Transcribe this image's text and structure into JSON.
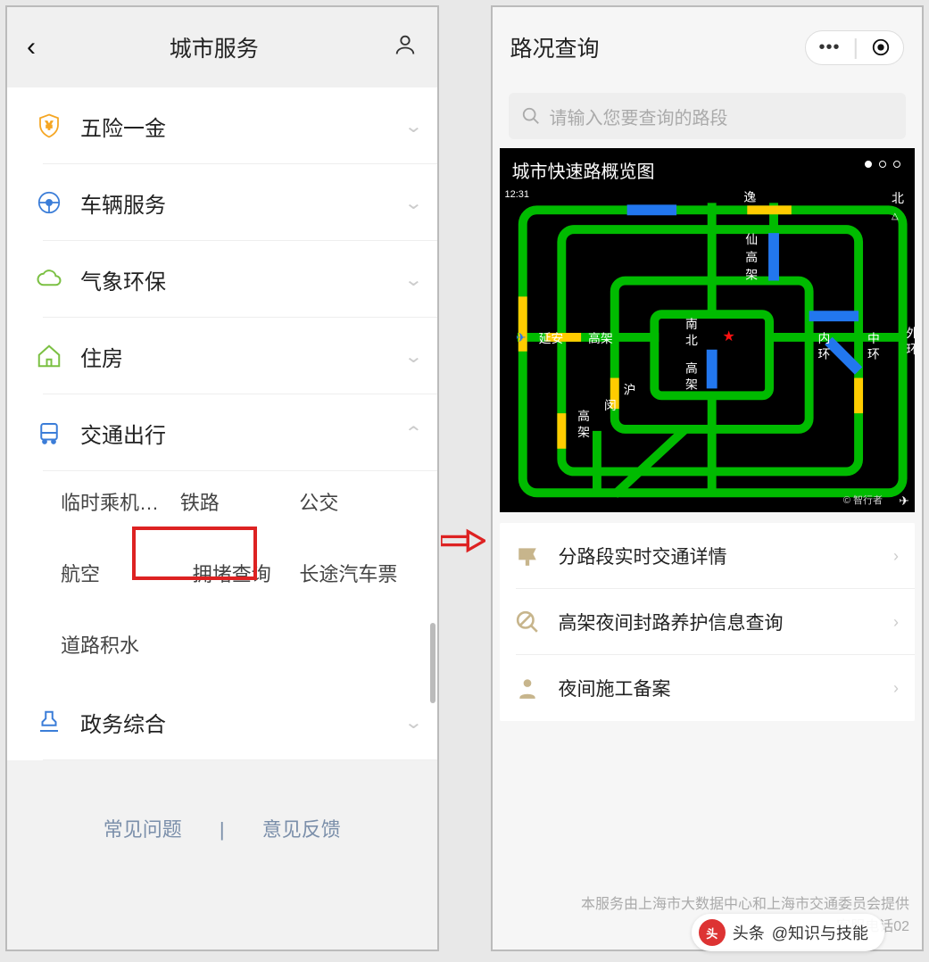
{
  "left": {
    "header": {
      "title": "城市服务"
    },
    "rows": [
      {
        "icon": "shield-yen",
        "label": "五险一金",
        "chev": "down"
      },
      {
        "icon": "wheel",
        "label": "车辆服务",
        "chev": "down"
      },
      {
        "icon": "cloud",
        "label": "气象环保",
        "chev": "down"
      },
      {
        "icon": "house",
        "label": "住房",
        "chev": "down"
      },
      {
        "icon": "bus",
        "label": "交通出行",
        "chev": "up"
      },
      {
        "icon": "stamp",
        "label": "政务综合",
        "chev": "down"
      }
    ],
    "subItems": [
      "临时乘机…",
      "铁路",
      "公交",
      "航空",
      "拥堵查询",
      "长途汽车票",
      "道路积水"
    ],
    "highlighted": "拥堵查询",
    "footer": {
      "faq": "常见问题",
      "feedback": "意见反馈"
    }
  },
  "right": {
    "header": {
      "title": "路况查询"
    },
    "search": {
      "placeholder": "请输入您要查询的路段"
    },
    "map": {
      "title": "城市快速路概览图",
      "time": "12:31",
      "compass": "北",
      "copyright": "© 智行者",
      "labels": [
        "逸",
        "仙",
        "高",
        "架",
        "南",
        "北",
        "高",
        "架",
        "沪",
        "闵",
        "高",
        "架",
        "延安",
        "高架",
        "内",
        "环",
        "中",
        "环",
        "外",
        "环"
      ]
    },
    "list": [
      {
        "label": "分路段实时交通详情"
      },
      {
        "label": "高架夜间封路养护信息查询"
      },
      {
        "label": "夜间施工备案"
      }
    ],
    "footer": {
      "line1": "本服务由上海市大数据中心和上海市交通委员会提供",
      "line2": "客服电话02"
    }
  },
  "watermark": {
    "prefix": "头条",
    "account": "@知识与技能"
  }
}
